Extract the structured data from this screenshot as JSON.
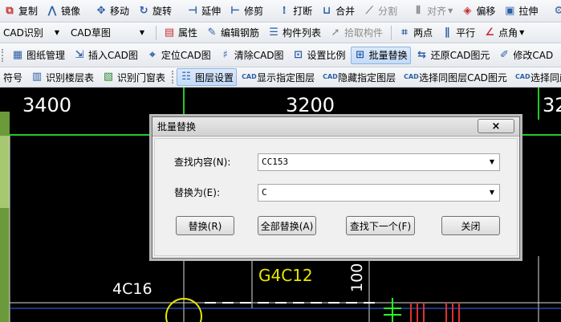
{
  "toolbar1": {
    "items": [
      {
        "label": "复制",
        "icon": "copy-icon"
      },
      {
        "label": "镜像",
        "icon": "mirror-icon"
      },
      {
        "label": "移动",
        "icon": "move-icon"
      },
      {
        "label": "旋转",
        "icon": "rotate-icon"
      },
      {
        "label": "延伸",
        "icon": "extend-icon"
      },
      {
        "label": "修剪",
        "icon": "trim-icon"
      },
      {
        "label": "打断",
        "icon": "break-icon"
      },
      {
        "label": "合并",
        "icon": "merge-icon"
      },
      {
        "label": "分割",
        "icon": "split-icon"
      },
      {
        "label": "对齐",
        "icon": "align-icon"
      },
      {
        "label": "偏移",
        "icon": "offset-icon"
      },
      {
        "label": "拉伸",
        "icon": "stretch-icon"
      },
      {
        "label": "设",
        "icon": "settings-icon"
      }
    ]
  },
  "toolbar2": {
    "combo1": "CAD识别",
    "combo2": "CAD草图",
    "items": [
      {
        "label": "属性",
        "icon": "properties-icon"
      },
      {
        "label": "编辑钢筋",
        "icon": "edit-rebar-icon"
      },
      {
        "label": "构件列表",
        "icon": "component-list-icon"
      },
      {
        "label": "拾取构件",
        "icon": "pick-component-icon"
      },
      {
        "label": "两点",
        "icon": "two-point-icon"
      },
      {
        "label": "平行",
        "icon": "parallel-icon"
      },
      {
        "label": "点角",
        "icon": "point-angle-icon"
      }
    ]
  },
  "toolbar3": {
    "items": [
      {
        "label": "图纸管理",
        "icon": "drawing-manage-icon"
      },
      {
        "label": "插入CAD图",
        "icon": "insert-cad-icon"
      },
      {
        "label": "定位CAD图",
        "icon": "locate-cad-icon"
      },
      {
        "label": "清除CAD图",
        "icon": "clear-cad-icon"
      },
      {
        "label": "设置比例",
        "icon": "set-scale-icon"
      },
      {
        "label": "批量替换",
        "icon": "batch-replace-icon"
      },
      {
        "label": "还原CAD图元",
        "icon": "restore-cad-icon"
      },
      {
        "label": "修改CAD",
        "icon": "modify-cad-icon"
      }
    ]
  },
  "toolbar4": {
    "items": [
      {
        "label": "符号",
        "icon": ""
      },
      {
        "label": "识别楼层表",
        "icon": "identify-floor-table-icon"
      },
      {
        "label": "识别门窗表",
        "icon": "identify-door-window-icon"
      },
      {
        "label": "图层设置",
        "icon": "layer-settings-icon"
      },
      {
        "label": "显示指定图层",
        "icon": "show-layer-icon"
      },
      {
        "label": "隐藏指定图层",
        "icon": "hide-layer-icon"
      },
      {
        "label": "选择同图层CAD图元",
        "icon": "select-same-layer-icon"
      },
      {
        "label": "选择同颜",
        "icon": "select-same-color-icon"
      }
    ]
  },
  "cad": {
    "dims": [
      "3400",
      "3200",
      "32"
    ],
    "labels": [
      "G4C12",
      "4C16",
      "100"
    ]
  },
  "dialog": {
    "title": "批量替换",
    "close": "×",
    "find_label": "查找内容(N):",
    "find_value": "CC153",
    "replace_label": "替换为(E):",
    "replace_value": "C",
    "btn_replace": "替换(R)",
    "btn_replace_all": "全部替换(A)",
    "btn_find_next": "查找下一个(F)",
    "btn_close": "关闭"
  }
}
